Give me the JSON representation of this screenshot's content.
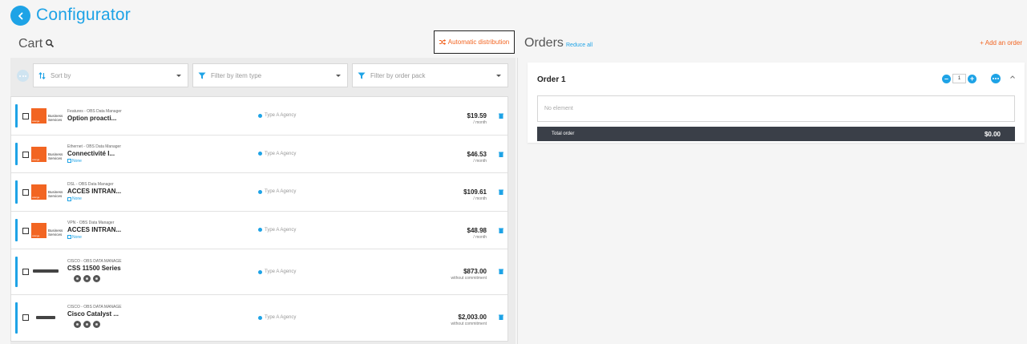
{
  "header": {
    "title": "Configurator",
    "back_icon": "chevron-left-icon"
  },
  "cart": {
    "label": "Cart",
    "auto_distribution_label": "Automatic distribution",
    "filters": {
      "sort_by": "Sort by",
      "item_type": "Filter by item type",
      "order_pack": "Filter by order pack"
    },
    "items": [
      {
        "kind": "service",
        "category": "Features - OBS Data Manager",
        "name": "Option proacti...",
        "subtitle": "",
        "agency": "Type A Agency",
        "price": "$19.59",
        "period": "/ month"
      },
      {
        "kind": "service",
        "category": "Ethernet - OBS Data Manager",
        "name": "Connectivité I...",
        "subtitle": "None",
        "agency": "Type A Agency",
        "price": "$46.53",
        "period": "/ month"
      },
      {
        "kind": "service",
        "category": "DSL - OBS Data Manager",
        "name": "ACCES INTRAN...",
        "subtitle": "None",
        "agency": "Type A Agency",
        "price": "$109.61",
        "period": "/ month"
      },
      {
        "kind": "service",
        "category": "VPN - OBS Data Manager",
        "name": "ACCES INTRAN...",
        "subtitle": "None",
        "agency": "Type A Agency",
        "price": "$48.98",
        "period": "/ month"
      },
      {
        "kind": "device",
        "category": "CISCO - OBS DATA MANAGE",
        "name": "CSS 11500 Series",
        "subtitle": "",
        "agency": "Type A Agency",
        "price": "$873.00",
        "period": "without commitment"
      },
      {
        "kind": "device",
        "category": "CISCO - OBS DATA MANAGE",
        "name": "Cisco Catalyst ...",
        "subtitle": "",
        "agency": "Type A Agency",
        "price": "$2,003.00",
        "period": "without commitment"
      }
    ],
    "logo_text": {
      "line1": "Business",
      "line2": "Services",
      "brand": "orange"
    }
  },
  "orders": {
    "label": "Orders",
    "reduce_all": "Reduce all",
    "add_order": "+ Add an order",
    "list": [
      {
        "title": "Order 1",
        "quantity": "1",
        "empty_text": "No element",
        "total_label": "Total order",
        "total_value": "$0.00"
      }
    ]
  },
  "colors": {
    "accent": "#1ea3e6",
    "orange": "#f26522",
    "dark": "#3a3f48"
  }
}
